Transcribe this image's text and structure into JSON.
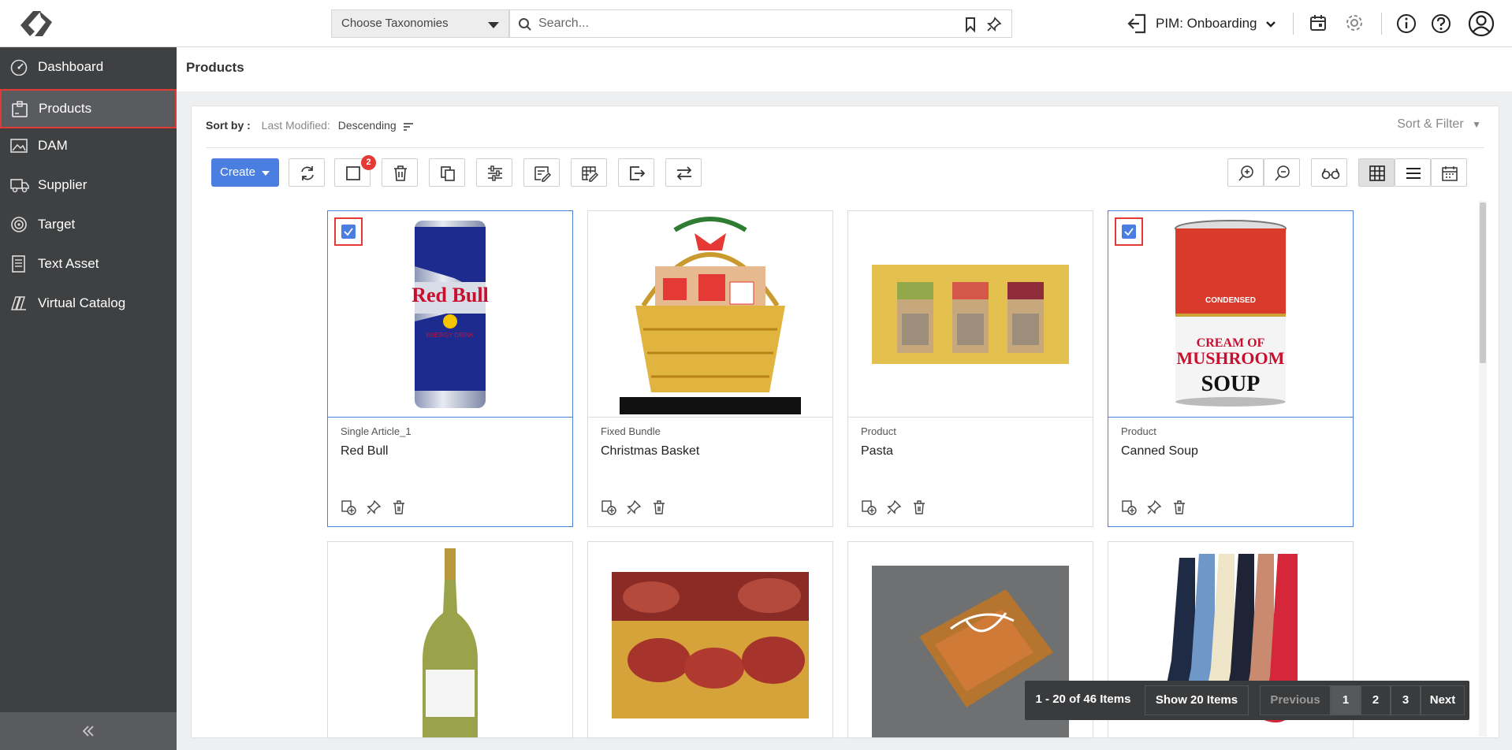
{
  "header": {
    "taxonomy_placeholder": "Choose Taxonomies",
    "search_placeholder": "Search...",
    "workspace": "PIM: Onboarding"
  },
  "sidebar": {
    "items": [
      {
        "label": "Dashboard",
        "icon": "dashboard-icon"
      },
      {
        "label": "Products",
        "icon": "products-icon",
        "active": true
      },
      {
        "label": "DAM",
        "icon": "image-icon"
      },
      {
        "label": "Supplier",
        "icon": "truck-icon"
      },
      {
        "label": "Target",
        "icon": "target-icon"
      },
      {
        "label": "Text Asset",
        "icon": "text-asset-icon"
      },
      {
        "label": "Virtual Catalog",
        "icon": "catalog-icon"
      }
    ]
  },
  "page": {
    "title": "Products"
  },
  "sort": {
    "label": "Sort by :",
    "field": "Last Modified:",
    "direction": "Descending",
    "sort_filter": "Sort & Filter"
  },
  "toolbar": {
    "create_label": "Create",
    "selected_count": "2"
  },
  "products": [
    {
      "type": "Single Article_1",
      "name": "Red Bull",
      "selected": true
    },
    {
      "type": "Fixed Bundle",
      "name": "Christmas Basket",
      "selected": false
    },
    {
      "type": "Product",
      "name": "Pasta",
      "selected": false
    },
    {
      "type": "Product",
      "name": "Canned Soup",
      "selected": true
    },
    {
      "type": "",
      "name": "",
      "selected": false
    },
    {
      "type": "",
      "name": "",
      "selected": false
    },
    {
      "type": "",
      "name": "",
      "selected": false
    },
    {
      "type": "",
      "name": "",
      "selected": false
    }
  ],
  "pagination": {
    "summary": "1 - 20 of 46 Items",
    "page_size": "Show 20 Items",
    "previous": "Previous",
    "pages": [
      "1",
      "2",
      "3"
    ],
    "current": "1",
    "next": "Next"
  },
  "colors": {
    "accent": "#4a7fe1",
    "sidebar": "#3f4042",
    "highlight": "#e53935"
  }
}
